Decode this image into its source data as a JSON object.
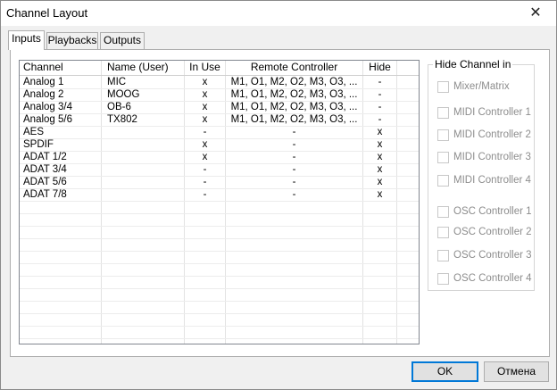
{
  "window": {
    "title": "Channel Layout",
    "close_glyph": "✕"
  },
  "tabs": [
    {
      "label": "Inputs"
    },
    {
      "label": "Playbacks"
    },
    {
      "label": "Outputs"
    }
  ],
  "table": {
    "headers": [
      "Channel",
      "Name (User)",
      "In Use",
      "Remote Controller",
      "Hide"
    ],
    "rows": [
      [
        "Analog 1",
        "MIC",
        "x",
        "M1, O1, M2, O2, M3, O3, ...",
        "-"
      ],
      [
        "Analog 2",
        "MOOG",
        "x",
        "M1, O1, M2, O2, M3, O3, ...",
        "-"
      ],
      [
        "Analog 3/4",
        "OB-6",
        "x",
        "M1, O1, M2, O2, M3, O3, ...",
        "-"
      ],
      [
        "Analog 5/6",
        "TX802",
        "x",
        "M1, O1, M2, O2, M3, O3, ...",
        "-"
      ],
      [
        "AES",
        "",
        "-",
        "-",
        "x"
      ],
      [
        "SPDIF",
        "",
        "x",
        "-",
        "x"
      ],
      [
        "ADAT 1/2",
        "",
        "x",
        "-",
        "x"
      ],
      [
        "ADAT 3/4",
        "",
        "-",
        "-",
        "x"
      ],
      [
        "ADAT 5/6",
        "",
        "-",
        "-",
        "x"
      ],
      [
        "ADAT 7/8",
        "",
        "-",
        "-",
        "x"
      ]
    ]
  },
  "hide_group": {
    "label": "Hide Channel in",
    "options": [
      {
        "label": "Mixer/Matrix",
        "checked": false,
        "enabled": false
      },
      {
        "label": "MIDI Controller 1",
        "checked": false,
        "enabled": false
      },
      {
        "label": "MIDI Controller 2",
        "checked": false,
        "enabled": false
      },
      {
        "label": "MIDI Controller 3",
        "checked": false,
        "enabled": false
      },
      {
        "label": "MIDI Controller 4",
        "checked": false,
        "enabled": false
      },
      {
        "label": "OSC Controller 1",
        "checked": false,
        "enabled": false
      },
      {
        "label": "OSC Controller 2",
        "checked": false,
        "enabled": false
      },
      {
        "label": "OSC Controller 3",
        "checked": false,
        "enabled": false
      },
      {
        "label": "OSC Controller 4",
        "checked": false,
        "enabled": false
      }
    ]
  },
  "buttons": {
    "ok": "OK",
    "cancel": "Отмена"
  }
}
